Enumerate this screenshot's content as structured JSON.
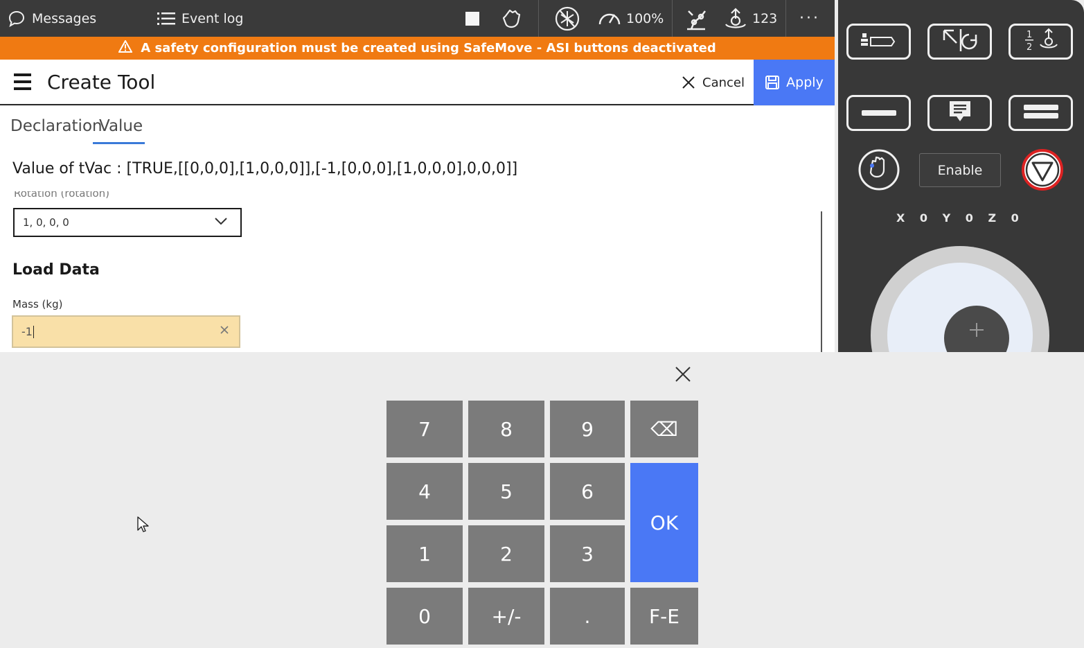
{
  "topbar": {
    "messages_label": "Messages",
    "eventlog_label": "Event log",
    "speed_label": "100%",
    "jog_increment_label": "123",
    "more_label": "···"
  },
  "banner": {
    "text": "A safety configuration must be created using SafeMove - ASI buttons deactivated"
  },
  "header": {
    "title": "Create Tool",
    "cancel_label": "Cancel",
    "apply_label": "Apply"
  },
  "tabs": [
    {
      "label": "Declaration"
    },
    {
      "label": "Value",
      "active": true
    }
  ],
  "form": {
    "value_of": "Value of tVac : [TRUE,[[0,0,0],[1,0,0,0]],[-1,[0,0,0],[1,0,0,0],0,0,0]]",
    "rotation_label": "Rotation (rotation)",
    "rotation_value": "1, 0, 0, 0",
    "load_data_heading": "Load Data",
    "mass_label": "Mass (kg)",
    "mass_value": "-1"
  },
  "rightpanel": {
    "enable_label": "Enable",
    "xyz_readout": "X 0 Y 0 Z 0"
  },
  "keypad": {
    "keys": [
      "7",
      "8",
      "9",
      "4",
      "5",
      "6",
      "1",
      "2",
      "3",
      "0",
      "+/-",
      "."
    ],
    "backspace_symbol": "⌫",
    "ok_label": "OK",
    "fe_label": "F-E"
  },
  "colors": {
    "topbar": "#3a3a3a",
    "banner": "#f07a12",
    "accent": "#4a78f5",
    "mass_field": "#f9e0a8",
    "key": "#7b7b7b"
  }
}
